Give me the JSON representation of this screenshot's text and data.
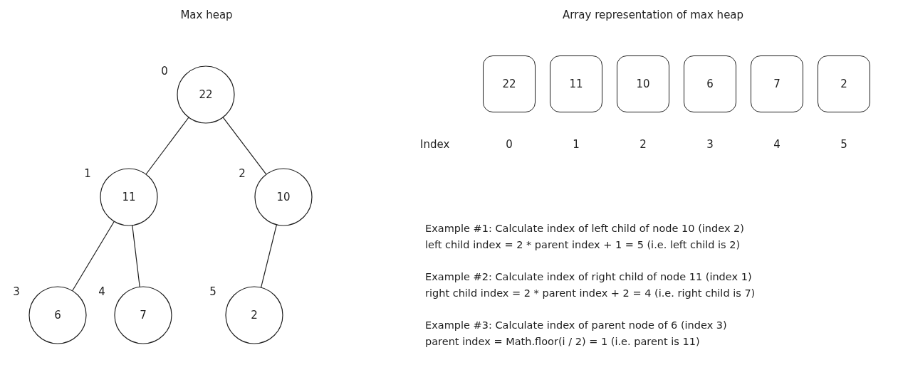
{
  "heap_tree": {
    "title": "Max heap",
    "root": {
      "value": "22",
      "index": "0",
      "children": [
        {
          "value": "11",
          "index": "1",
          "children": [
            {
              "value": "6",
              "index": "3"
            },
            {
              "value": "7",
              "index": "4"
            }
          ]
        },
        {
          "value": "10",
          "index": "2",
          "children": [
            {
              "value": "2",
              "index": "5"
            }
          ]
        }
      ]
    }
  },
  "array": {
    "title": "Array representation of max heap",
    "index_label": "Index",
    "cells": [
      {
        "value": "22",
        "index": "0"
      },
      {
        "value": "11",
        "index": "1"
      },
      {
        "value": "10",
        "index": "2"
      },
      {
        "value": "6",
        "index": "3"
      },
      {
        "value": "7",
        "index": "4"
      },
      {
        "value": "2",
        "index": "5"
      }
    ]
  },
  "examples": [
    {
      "lines": [
        "Example #1: Calculate index of left child of node 10 (index 2)",
        "left child index = 2 * parent index + 1 = 5 (i.e. left child is 2)"
      ]
    },
    {
      "lines": [
        "Example #2: Calculate index of right child of node 11 (index 1)",
        "right child index = 2 * parent index + 2 = 4 (i.e. right child is 7)"
      ]
    },
    {
      "lines": [
        "Example #3: Calculate index of parent node of 6 (index 3)",
        "parent index = Math.floor(i / 2) = 1 (i.e. parent is 11)"
      ]
    }
  ]
}
